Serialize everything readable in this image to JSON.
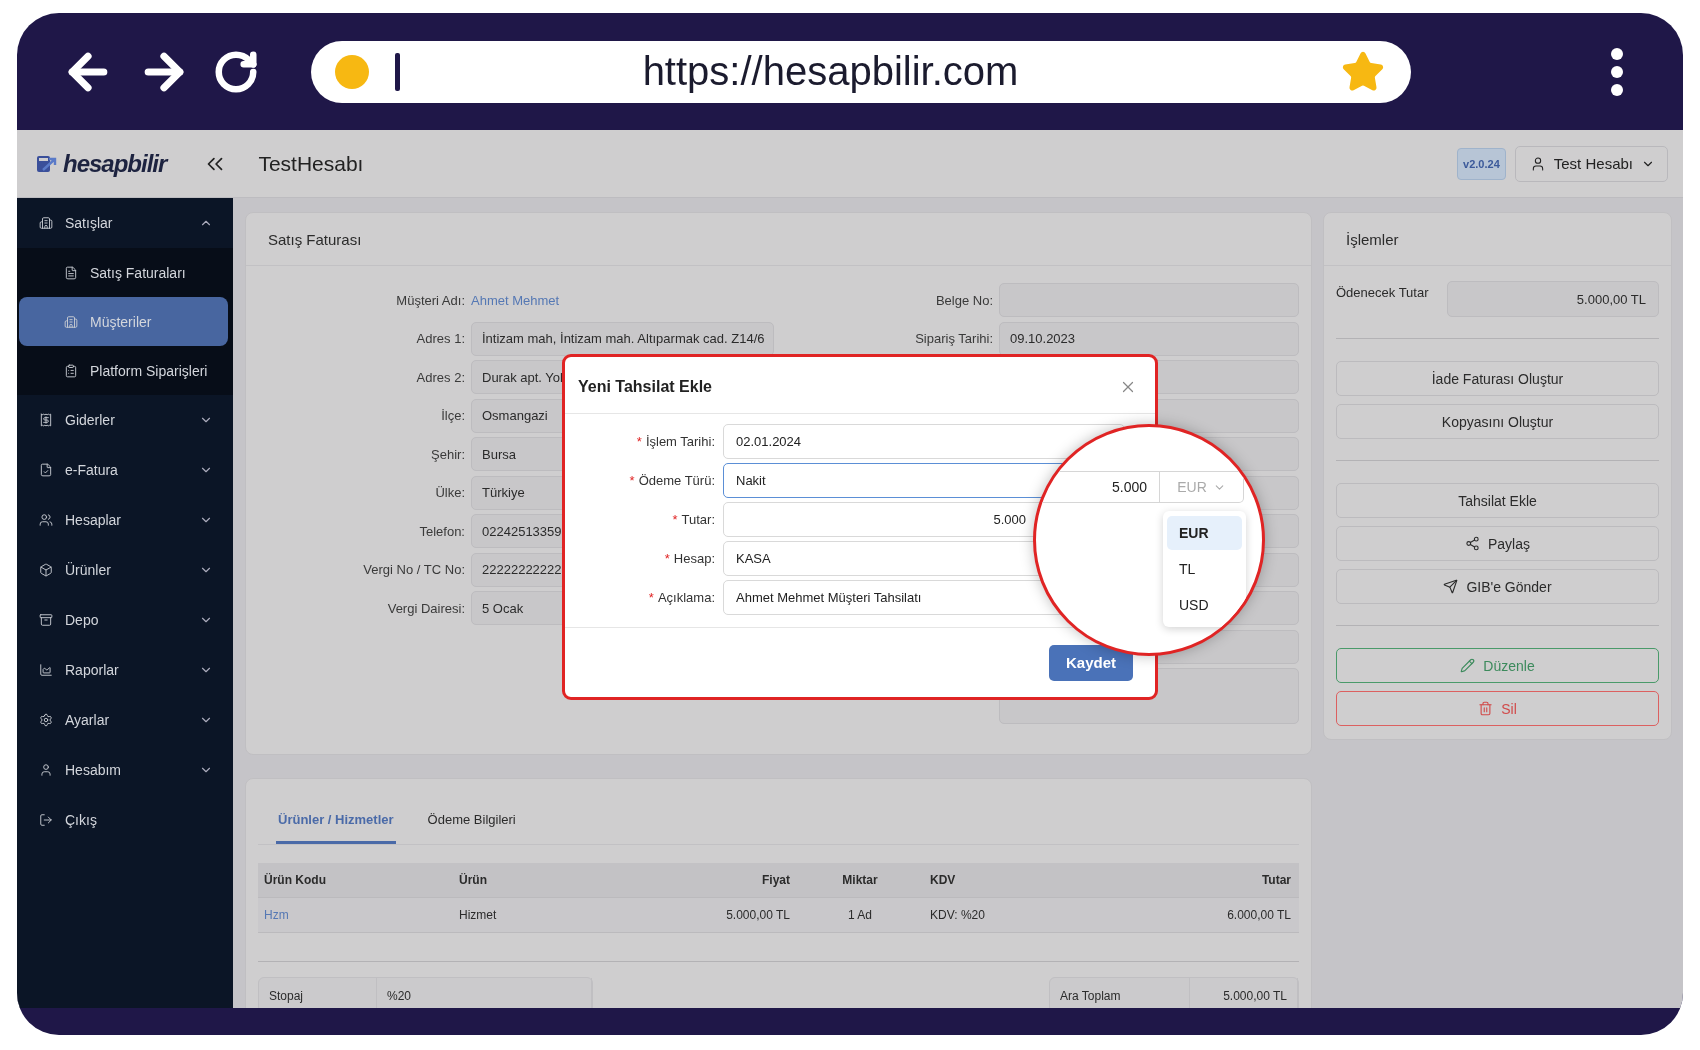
{
  "browser": {
    "url": "https://hesapbilir.com"
  },
  "header": {
    "logo": "hesapbilir",
    "title": "TestHesabı",
    "version": "v2.0.24",
    "user": "Test Hesabı"
  },
  "sidebar": {
    "items": [
      {
        "label": "Satışlar",
        "kind": "group",
        "expanded": true,
        "children": [
          {
            "label": "Satış Faturaları",
            "selected": false
          },
          {
            "label": "Müşteriler",
            "selected": true
          },
          {
            "label": "Platform Siparişleri",
            "selected": false
          }
        ]
      },
      {
        "label": "Giderler",
        "kind": "group",
        "expanded": false
      },
      {
        "label": "e-Fatura",
        "kind": "group",
        "expanded": false
      },
      {
        "label": "Hesaplar",
        "kind": "group",
        "expanded": false
      },
      {
        "label": "Ürünler",
        "kind": "group",
        "expanded": false
      },
      {
        "label": "Depo",
        "kind": "group",
        "expanded": false
      },
      {
        "label": "Raporlar",
        "kind": "group",
        "expanded": false
      },
      {
        "label": "Ayarlar",
        "kind": "group",
        "expanded": false
      },
      {
        "label": "Hesabım",
        "kind": "group",
        "expanded": false
      },
      {
        "label": "Çıkış",
        "kind": "action"
      }
    ]
  },
  "invoice": {
    "title": "Satış Faturası",
    "left_fields": [
      {
        "label": "Müşteri Adı:",
        "value": "Ahmet Mehmet",
        "kind": "link"
      },
      {
        "label": "Adres 1:",
        "value": "İntizam mah, İntizam mah. Altıparmak cad. Z14/6",
        "kind": "input"
      },
      {
        "label": "Adres 2:",
        "value": "Durak apt. Yol",
        "kind": "input"
      },
      {
        "label": "İlçe:",
        "value": "Osmangazi",
        "kind": "input"
      },
      {
        "label": "Şehir:",
        "value": "Bursa",
        "kind": "input"
      },
      {
        "label": "Ülke:",
        "value": "Türkiye",
        "kind": "input"
      },
      {
        "label": "Telefon:",
        "value": "02242513359",
        "kind": "input"
      },
      {
        "label": "Vergi No / TC No:",
        "value": "22222222222",
        "kind": "input"
      },
      {
        "label": "Vergi Dairesi:",
        "value": "5 Ocak",
        "kind": "input"
      }
    ],
    "right_fields": [
      {
        "label": "Belge No:",
        "kind": "input"
      },
      {
        "label": "Sipariş Tarihi:",
        "value": "09.10.2023",
        "kind": "input"
      },
      {
        "kind": "input"
      },
      {
        "kind": "input"
      },
      {
        "kind": "input"
      },
      {
        "kind": "input"
      },
      {
        "kind": "input"
      },
      {
        "kind": "input"
      },
      {
        "kind": "input"
      },
      {
        "kind": "input"
      },
      {
        "kind": "textarea"
      }
    ]
  },
  "actions": {
    "title": "İşlemler",
    "due_label": "Ödenecek Tutar",
    "due_value": "5.000,00 TL",
    "groups": [
      [
        {
          "label": "İade Faturası Oluştur",
          "kind": "plain"
        },
        {
          "label": "Kopyasını Oluştur",
          "kind": "plain"
        }
      ],
      [
        {
          "label": "Tahsilat Ekle",
          "kind": "plain"
        },
        {
          "label": "Paylaş",
          "kind": "share"
        },
        {
          "label": "GIB'e Gönder",
          "kind": "send"
        }
      ],
      [
        {
          "label": "Düzenle",
          "kind": "edit"
        },
        {
          "label": "Sil",
          "kind": "delete"
        }
      ]
    ]
  },
  "items": {
    "tabs": [
      {
        "label": "Ürünler / Hizmetler",
        "selected": true
      },
      {
        "label": "Ödeme Bilgileri",
        "selected": false
      }
    ],
    "columns": [
      "Ürün Kodu",
      "Ürün",
      "Fiyat",
      "Miktar",
      "KDV",
      "Tutar"
    ],
    "rows": [
      [
        "Hzm",
        "Hizmet",
        "5.000,00 TL",
        "1 Ad",
        "KDV: %20",
        "6.000,00 TL"
      ]
    ],
    "summary_left": {
      "label": "Stopaj",
      "value": "%20"
    },
    "summary_right": {
      "label": "Ara Toplam",
      "value": "5.000,00 TL"
    }
  },
  "modal": {
    "title": "Yeni Tahsilat Ekle",
    "fields": [
      {
        "mark": "*",
        "label": "İşlem Tarihi:",
        "value": "02.01.2024",
        "kind": "date",
        "focused": false
      },
      {
        "mark": "*",
        "label": "Ödeme Türü:",
        "value": "Nakit",
        "kind": "select",
        "focused": true
      },
      {
        "mark": "*",
        "label": "Tutar:",
        "value": "5.000",
        "kind": "amount",
        "focused": false
      },
      {
        "mark": "*",
        "label": "Hesap:",
        "value": "KASA",
        "kind": "select",
        "focused": false
      },
      {
        "mark": "*",
        "label": "Açıklama:",
        "value": "Ahmet Mehmet Müşteri Tahsilatı",
        "kind": "text",
        "focused": false
      }
    ],
    "save": "Kaydet",
    "magnifier": {
      "amount": "5.000",
      "currency": "EUR",
      "options": [
        {
          "label": "EUR",
          "selected": true
        },
        {
          "label": "TL",
          "selected": false
        },
        {
          "label": "USD",
          "selected": false
        }
      ]
    }
  }
}
